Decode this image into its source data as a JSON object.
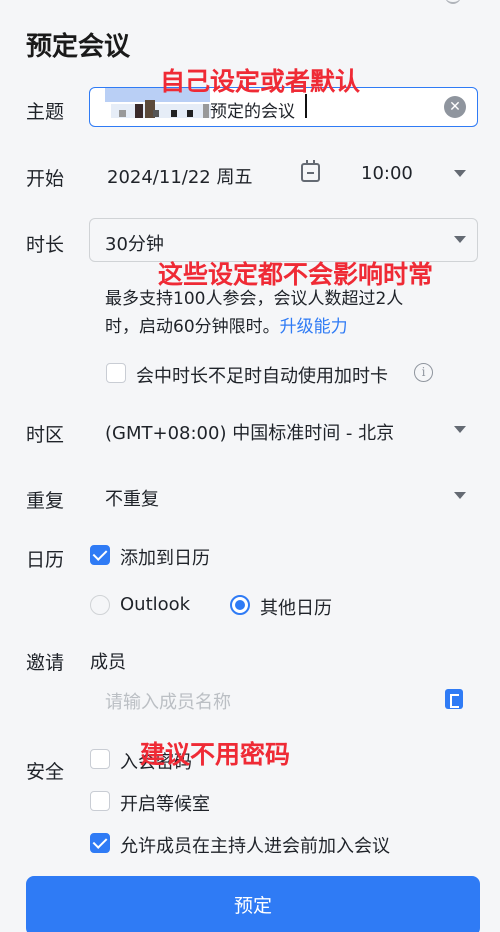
{
  "dialog": {
    "title": "预定会议"
  },
  "subject": {
    "label": "主题",
    "value": "预定的会议"
  },
  "start": {
    "label": "开始",
    "date": "2024/11/22 周五",
    "time": "10:00"
  },
  "duration": {
    "label": "时长",
    "value": "30分钟",
    "note_line1": "最多支持100人参会，会议人数超过2人",
    "note_line2": "时，启动60分钟限时。",
    "upgrade_link": "升级能力",
    "addon_option": "会中时长不足时自动使用加时卡",
    "addon_checked": false
  },
  "timezone": {
    "label": "时区",
    "value": "(GMT+08:00) 中国标准时间 - 北京"
  },
  "repeat": {
    "label": "重复",
    "value": "不重复"
  },
  "calendar": {
    "label": "日历",
    "add_to_calendar": "添加到日历",
    "add_checked": true,
    "options": [
      "Outlook",
      "其他日历"
    ],
    "selected": "其他日历"
  },
  "invite": {
    "label": "邀请",
    "members_label": "成员",
    "placeholder": "请输入成员名称"
  },
  "security": {
    "label": "安全",
    "options": [
      {
        "label": "入会密码",
        "checked": false
      },
      {
        "label": "开启等候室",
        "checked": false
      },
      {
        "label": "允许成员在主持人进会前加入会议",
        "checked": true
      }
    ]
  },
  "annotations": {
    "subject_note": "自己设定或者默认",
    "duration_note": "这些设定都不会影响时常",
    "security_note": "建议不用密码"
  },
  "submit": {
    "label": "预定"
  },
  "colors": {
    "accent": "#2f7bf5",
    "annotation": "#ef2a35"
  }
}
